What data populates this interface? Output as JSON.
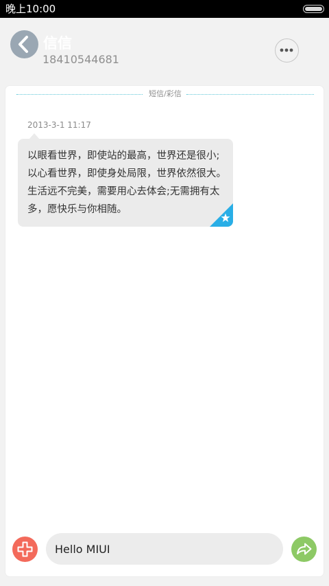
{
  "status_bar": {
    "time": "晚上10:00",
    "battery_icon": "battery-icon"
  },
  "header": {
    "back_icon": "chevron-left-icon",
    "contact_name": "信信",
    "contact_number": "18410544681",
    "more_icon": "more-horizontal-icon"
  },
  "conversation": {
    "channel_label": "短信/彩信",
    "messages": [
      {
        "time": "2013-3-1 11:17",
        "text": "以眼看世界，即使站的最高，世界还是很小;以心看世界，即使身处局限，世界依然很大。生活远不完美，需要用心去体会;无需拥有太多，愿快乐与你相随。",
        "starred": true,
        "star_icon": "star-icon"
      }
    ]
  },
  "composer": {
    "attach_icon": "plus-icon",
    "input_value": "Hello MIUI",
    "send_icon": "send-arrow-icon"
  },
  "colors": {
    "accent_blue": "#29aee6",
    "attach_red": "#f36a5b",
    "send_green": "#8dc965",
    "divider": "#5cc6d8"
  }
}
